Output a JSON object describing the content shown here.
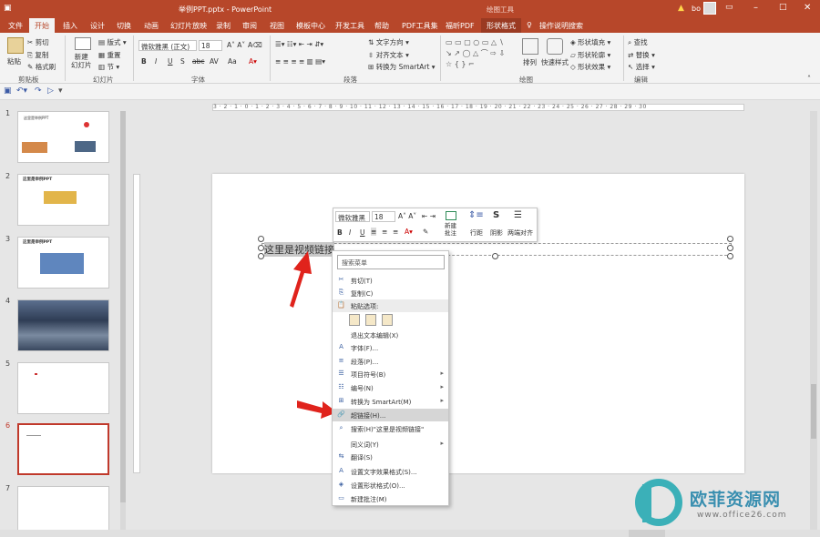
{
  "titlebar": {
    "doc_title": "举例PPT.pptx  -  PowerPoint",
    "context_label": "绘图工具",
    "user": "bo",
    "help_icon": "warning-icon"
  },
  "tabs": [
    "文件",
    "开始",
    "插入",
    "设计",
    "切换",
    "动画",
    "幻灯片放映",
    "录制",
    "审阅",
    "视图",
    "模板中心",
    "开发工具",
    "帮助",
    "PDF工具集",
    "福昕PDF"
  ],
  "context_tab": "形状格式",
  "tell_me": "操作说明搜索",
  "active_tab": "开始",
  "ribbon": {
    "clipboard": {
      "paste": "粘贴",
      "cut": "剪切",
      "copy": "复制",
      "painter": "格式刷",
      "group": "剪贴板"
    },
    "slides": {
      "new_slide": "新建\n幻灯片",
      "layout": "版式",
      "reset": "重置",
      "section": "节",
      "group": "幻灯片"
    },
    "font": {
      "name": "微软雅黑 (正文)",
      "size": "18",
      "group": "字体"
    },
    "paragraph": {
      "text_dir": "文字方向",
      "align_text": "对齐文本",
      "smartart": "转换为 SmartArt",
      "group": "段落"
    },
    "drawing": {
      "arrange": "排列",
      "quick_styles": "快速样式",
      "fill": "形状填充",
      "outline": "形状轮廓",
      "effects": "形状效果",
      "group": "绘图"
    },
    "editing": {
      "find": "查找",
      "replace": "替换",
      "select": "选择",
      "group": "编辑"
    }
  },
  "thumbnails": [
    {
      "num": "1",
      "title": "这里是举例PPT"
    },
    {
      "num": "2",
      "title": "这里是举例PPT"
    },
    {
      "num": "3",
      "title": "这里是举例PPT"
    },
    {
      "num": "4",
      "title": ""
    },
    {
      "num": "5",
      "title": ""
    },
    {
      "num": "6",
      "title": ""
    },
    {
      "num": "7",
      "title": ""
    }
  ],
  "slide": {
    "textbox": "这里是视频链接"
  },
  "minibar": {
    "font": "微软雅黑",
    "size": "18",
    "new_comment": "新建\n批注",
    "line_spacing": "行距",
    "shadow": "阴影",
    "two_align": "两端对齐"
  },
  "context_menu": {
    "search_placeholder": "搜索菜单",
    "items": [
      {
        "label": "剪切(T)",
        "icon": "scissors-icon"
      },
      {
        "label": "复制(C)",
        "icon": "copy-icon"
      },
      {
        "label": "粘贴选项:",
        "icon": "paste-icon",
        "header": true
      },
      {
        "label": "退出文本编辑(X)",
        "icon": ""
      },
      {
        "label": "字体(F)...",
        "icon": "font-icon"
      },
      {
        "label": "段落(P)...",
        "icon": "paragraph-icon"
      },
      {
        "label": "项目符号(B)",
        "icon": "bullets-icon",
        "submenu": true
      },
      {
        "label": "编号(N)",
        "icon": "numbering-icon",
        "submenu": true
      },
      {
        "label": "转换为 SmartArt(M)",
        "icon": "smartart-icon",
        "submenu": true
      },
      {
        "label": "超链接(H)...",
        "icon": "link-icon",
        "highlight": true
      },
      {
        "label": "搜索(H)\"这里是视频链接\"",
        "icon": "search-icon"
      },
      {
        "label": "同义词(Y)",
        "icon": "",
        "submenu": true
      },
      {
        "label": "翻译(S)",
        "icon": "translate-icon"
      },
      {
        "label": "设置文字效果格式(S)...",
        "icon": "text-effects-icon"
      },
      {
        "label": "设置形状格式(O)...",
        "icon": "shape-format-icon"
      },
      {
        "label": "新建批注(M)",
        "icon": "comment-icon"
      }
    ]
  },
  "watermark": {
    "brand": "欧菲资源网",
    "url": "www.office26.com"
  }
}
